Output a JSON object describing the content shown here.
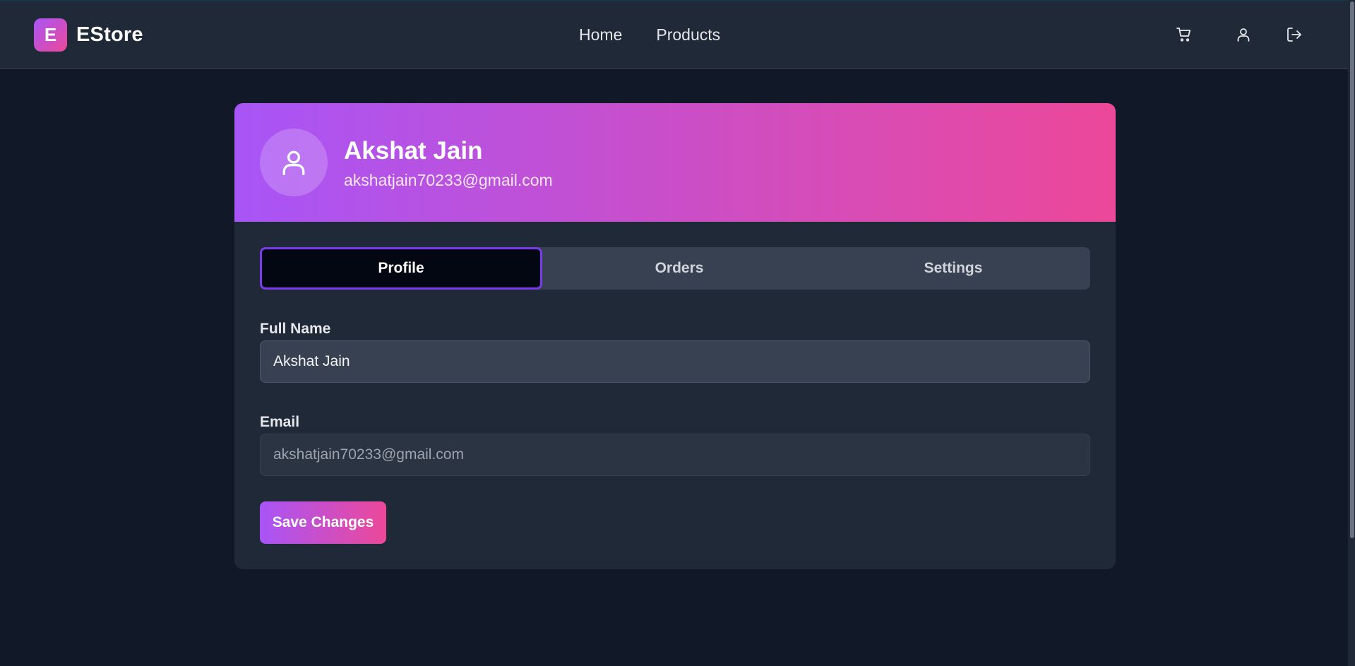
{
  "brand": {
    "logo_letter": "E",
    "name": "EStore"
  },
  "nav": {
    "items": [
      {
        "label": "Home"
      },
      {
        "label": "Products"
      }
    ]
  },
  "header_icons": [
    "cart-icon",
    "user-icon",
    "logout-icon"
  ],
  "profile": {
    "name": "Akshat Jain",
    "email": "akshatjain70233@gmail.com"
  },
  "tabs": [
    {
      "label": "Profile",
      "active": true
    },
    {
      "label": "Orders",
      "active": false
    },
    {
      "label": "Settings",
      "active": false
    }
  ],
  "form": {
    "full_name_label": "Full Name",
    "full_name_value": "Akshat Jain",
    "email_label": "Email",
    "email_value": "akshatjain70233@gmail.com",
    "save_label": "Save Changes"
  },
  "colors": {
    "gradient_start": "#a855f7",
    "gradient_end": "#ec4899",
    "background": "#111827",
    "card": "#1f2937",
    "active_tab_border": "#7c3aed"
  }
}
